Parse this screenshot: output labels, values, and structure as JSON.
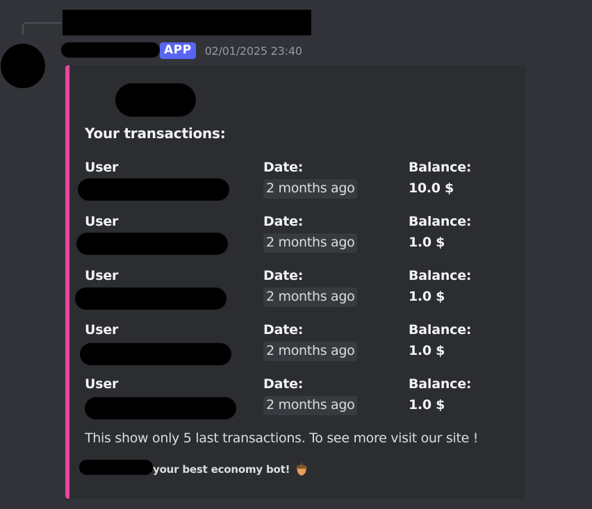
{
  "message": {
    "badge": "APP",
    "timestamp": "02/01/2025 23:40"
  },
  "embed": {
    "accent_color": "#eb459e",
    "title": "Your transactions:",
    "fields": [
      {
        "user_label": "User",
        "date_label": "Date:",
        "date_value": "2 months ago",
        "balance_label": "Balance:",
        "balance_value": "10.0 $"
      },
      {
        "user_label": "User",
        "date_label": "Date:",
        "date_value": "2 months ago",
        "balance_label": "Balance:",
        "balance_value": "1.0 $"
      },
      {
        "user_label": "User",
        "date_label": "Date:",
        "date_value": "2 months ago",
        "balance_label": "Balance:",
        "balance_value": "1.0 $"
      },
      {
        "user_label": "User",
        "date_label": "Date:",
        "date_value": "2 months ago",
        "balance_label": "Balance:",
        "balance_value": "1.0 $"
      },
      {
        "user_label": "User",
        "date_label": "Date:",
        "date_value": "2 months ago",
        "balance_label": "Balance:",
        "balance_value": "1.0 $"
      }
    ],
    "description": "This show only 5 last transactions. To see more visit our site !",
    "footer_text": "your best economy bot!",
    "footer_icon": "acorn-icon"
  }
}
